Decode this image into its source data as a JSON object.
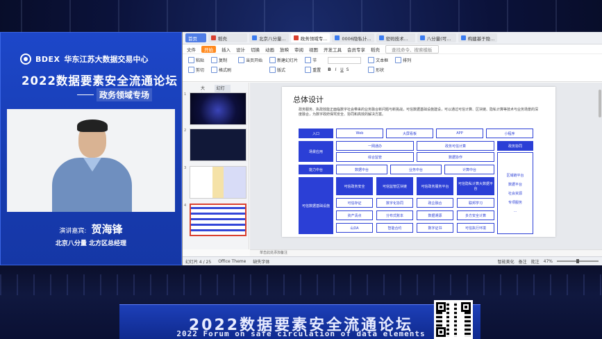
{
  "event": {
    "org_en": "BDEX",
    "org_cn": "华东江苏大数据交易中心",
    "forum_title": "2022数据要素安全流通论坛",
    "sub_title": "政务领域专场",
    "speaker_label": "演讲嘉宾:",
    "speaker_name": "贺海锋",
    "speaker_org": "北京八分量 北方区总经理",
    "banner_cn": "2022数据要素安全流通论坛",
    "banner_en": "2022 Forum on safe circulation of data elements"
  },
  "app": {
    "tabs": [
      {
        "label": "首页",
        "icon": "home-icon"
      },
      {
        "label": "稻壳",
        "icon": "docer-icon"
      },
      {
        "label": "北京八分量...",
        "icon": "wps-doc-icon"
      },
      {
        "label": "政务领域专...",
        "icon": "ppt-icon"
      },
      {
        "label": "0006隐私计...",
        "icon": "wps-doc-icon"
      },
      {
        "label": "密码技术...",
        "icon": "wps-doc-icon"
      },
      {
        "label": "八分量(可...",
        "icon": "wps-doc-icon"
      },
      {
        "label": "构建基于隐...",
        "icon": "wps-doc-icon"
      }
    ],
    "ribbon_tabs": [
      "文件",
      "开始",
      "插入",
      "设计",
      "切换",
      "动画",
      "放映",
      "审阅",
      "视图",
      "开发工具",
      "会员专享",
      "稻壳",
      "查找命令、搜索模板"
    ],
    "ribbon_active": "开始",
    "ribbon_tools": [
      "粘贴",
      "剪切",
      "复制",
      "格式刷",
      "当页开始",
      "新建幻灯片",
      "版式",
      "节",
      "重置",
      "文本框",
      "形状",
      "排列"
    ],
    "panel_tabs": [
      "大纲",
      "幻灯片"
    ],
    "panel_active": "幻灯片",
    "thumb_numbers": [
      "1",
      "2",
      "3",
      "4"
    ],
    "notes_placeholder": "单击此处添加备注",
    "status": {
      "slide_counter": "幻灯片 4 / 25",
      "theme": "Office Theme",
      "font_missing": "缺失字体",
      "smart_beautify": "智能美化",
      "notes": "备注",
      "comments": "批注",
      "zoom": "47%"
    }
  },
  "slide": {
    "title": "总体设计",
    "description": "政务服务、执政效能正面临数字社会带来的业务融合新问题与新挑战，可信数据基础设施建设，可以通过可信计算、区块链、隐私计算等技术与业务场景的深度融合，为数字政府保驾安全、协同和高效的解决方案。",
    "rows": {
      "entry_label": "入口",
      "entry_items": [
        "Web",
        "大屏看板",
        "APP",
        "小程序"
      ],
      "portal_label": "场景应用",
      "portal_items": [
        "一网通办",
        "政务可信计算",
        "综合监管",
        "数据协作"
      ],
      "middle_label": "能力中台",
      "middle_items": [
        "数据中台",
        "业务中台",
        "计算中台"
      ],
      "infra_label": "可信数据基础设施",
      "infra_dark": [
        "可信政务安全",
        "可信监管区块链",
        "可信政务服务平台",
        "可信隐私计算大数据平台"
      ],
      "infra_items": [
        "可信存证",
        "数字化协同",
        "政企融合",
        "联邦学习",
        "资产清点",
        "分布式账本",
        "数据溯源",
        "多方安全计算",
        "山DA",
        "智能合约",
        "数字证书",
        "可信执行环境"
      ],
      "side_label": "政务协同",
      "side_items": [
        "区域链平台",
        "数据平台",
        "社会资源",
        "专项服务",
        "..."
      ]
    }
  }
}
